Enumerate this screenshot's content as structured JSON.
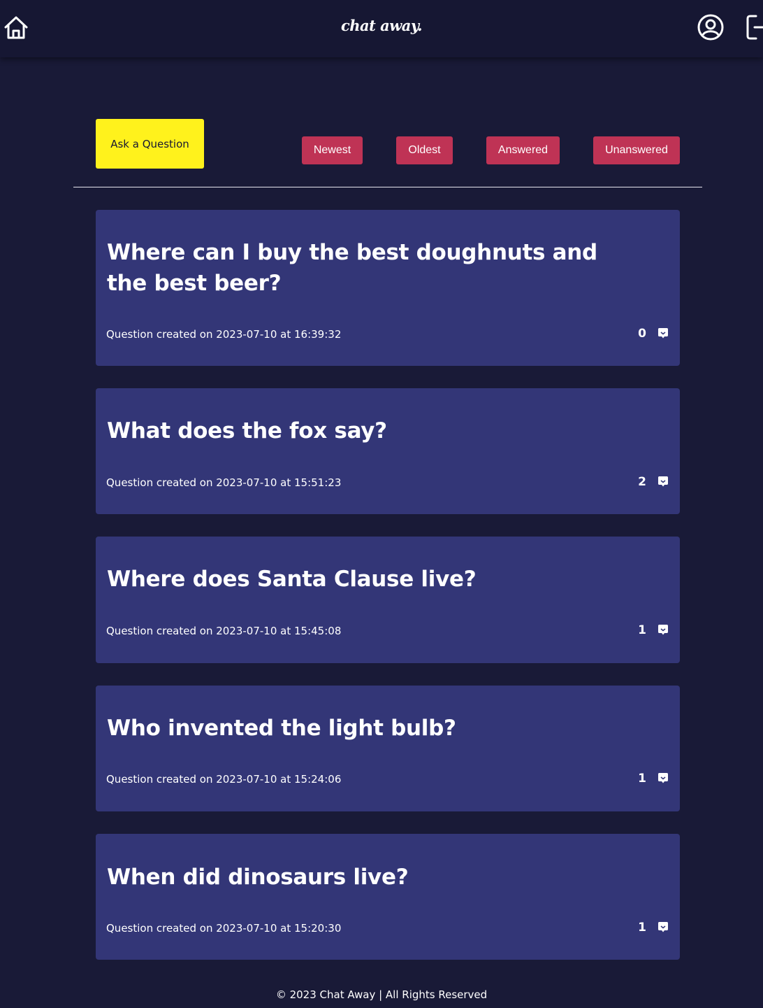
{
  "header": {
    "logo_text": "chat away.",
    "icons": [
      "home-icon",
      "user-circle-icon",
      "logout-icon"
    ]
  },
  "toolbar": {
    "ask_label": "Ask a Question",
    "filters": {
      "newest": "Newest",
      "oldest": "Oldest",
      "answered": "Answered",
      "unanswered": "Unanswered"
    }
  },
  "questions": [
    {
      "title": "Where can I buy the best doughnuts and the best beer?",
      "created": "Question created on 2023-07-10 at 16:39:32",
      "answer_count": "0"
    },
    {
      "title": "What does the fox say?",
      "created": "Question created on 2023-07-10 at 15:51:23",
      "answer_count": "2"
    },
    {
      "title": "Where does Santa Clause live?",
      "created": "Question created on 2023-07-10 at 15:45:08",
      "answer_count": "1"
    },
    {
      "title": "Who invented the light bulb?",
      "created": "Question created on 2023-07-10 at 15:24:06",
      "answer_count": "1"
    },
    {
      "title": "When did dinosaurs live?",
      "created": "Question created on 2023-07-10 at 15:20:30",
      "answer_count": "1"
    }
  ],
  "footer": {
    "text": "© 2023 Chat Away | All Rights Reserved"
  },
  "colors": {
    "background": "#191a37",
    "header": "#161733",
    "card": "#333677",
    "ask_button": "#fff21c",
    "filter_button": "#bf3355"
  }
}
